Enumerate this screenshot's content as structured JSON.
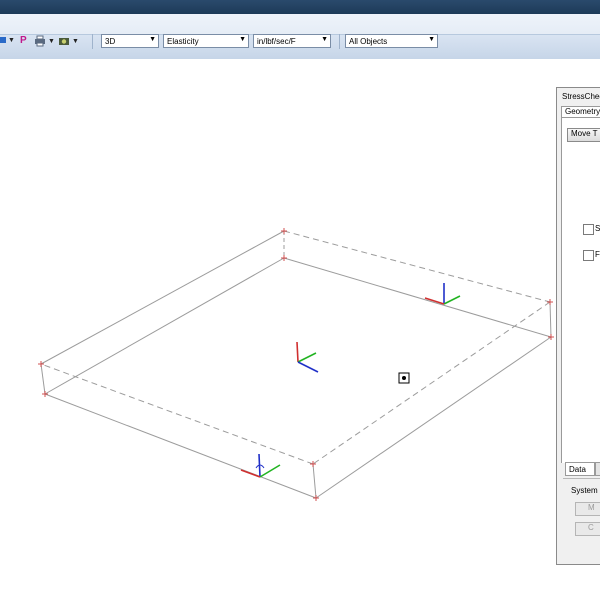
{
  "toolbar": {
    "p_icon": "P",
    "view_mode": "3D",
    "analysis_type": "Elasticity",
    "units": "in/lbf/sec/F",
    "object_filter": "All Objects"
  },
  "panel": {
    "title": "StressCheck",
    "tab_geometry": "Geometry",
    "move_button": "Move T",
    "checkbox_1_label": "S",
    "checkbox_2_label": "F",
    "tab_data": "Data",
    "group_label": "System",
    "button_1": "M",
    "button_2": "C"
  },
  "icons": [
    "toolbar-tool-icon",
    "p-icon",
    "print-icon",
    "camera-icon",
    "cursor-target-icon",
    "axis-triad-icon"
  ],
  "colors": {
    "axis_x": "#d03030",
    "axis_y": "#22b422",
    "axis_z": "#2030c8",
    "edge": "#9c9c9c"
  }
}
